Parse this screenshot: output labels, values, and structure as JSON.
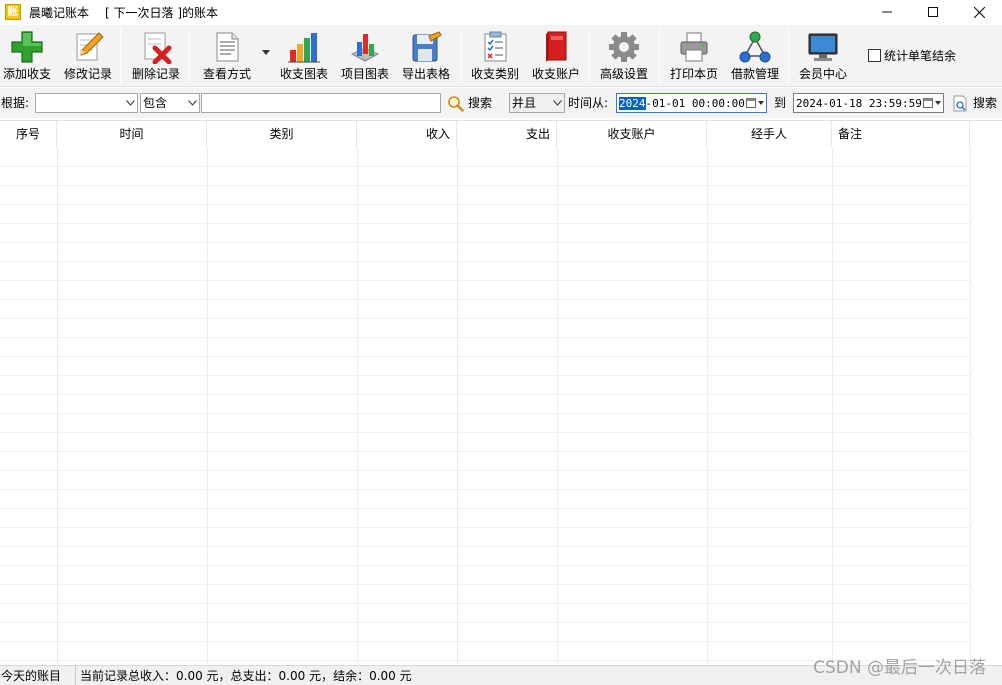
{
  "window": {
    "app_name": "晨曦记账本",
    "book_title": "[ 下一次日落 ]的账本",
    "app_icon_char": "账"
  },
  "toolbar": {
    "buttons": [
      {
        "label": "添加收支",
        "icon": "add-icon"
      },
      {
        "label": "修改记录",
        "icon": "edit-pencil-icon"
      },
      {
        "label": "删除记录",
        "icon": "delete-icon"
      },
      {
        "label": "查看方式",
        "icon": "view-document-icon"
      },
      {
        "label": "收支图表",
        "icon": "bar-chart-icon"
      },
      {
        "label": "项目图表",
        "icon": "3d-chart-icon"
      },
      {
        "label": "导出表格",
        "icon": "export-icon"
      },
      {
        "label": "收支类别",
        "icon": "category-checklist-icon"
      },
      {
        "label": "收支账户",
        "icon": "account-book-icon"
      },
      {
        "label": "高级设置",
        "icon": "gear-icon"
      },
      {
        "label": "打印本页",
        "icon": "printer-icon"
      },
      {
        "label": "借款管理",
        "icon": "network-icon"
      },
      {
        "label": "会员中心",
        "icon": "monitor-icon"
      }
    ],
    "checkbox_label": "统计单笔结余",
    "checkbox_checked": false
  },
  "search": {
    "by_label": "根据:",
    "field_value": "",
    "match_value": "包含",
    "keyword_value": "",
    "search_label": "搜索",
    "logic_value": "并且",
    "time_from_label": "时间从:",
    "date_from_highlight": "2024",
    "date_from_rest": "-01-01 00:00:00",
    "to_label": "到",
    "date_to": "2024-01-18 23:59:59",
    "search2_label": "搜索"
  },
  "table": {
    "columns": [
      "序号",
      "时间",
      "类别",
      "收入",
      "支出",
      "收支账户",
      "经手人",
      "备注"
    ],
    "rows": []
  },
  "status": {
    "left": "今天的账目",
    "summary": "当前记录总收入：0.00 元，总支出：0.00 元，结余：0.00 元"
  },
  "watermark": "CSDN @最后一次日落",
  "colors": {
    "selection": "#0a62c8",
    "toolbar_bg": "#f3f3f3"
  }
}
